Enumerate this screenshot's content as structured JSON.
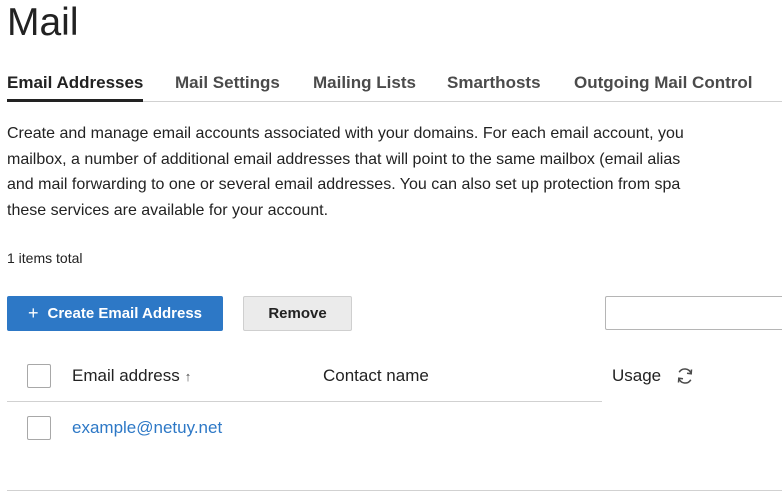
{
  "page": {
    "title": "Mail"
  },
  "tabs": [
    {
      "label": "Email Addresses",
      "active": true
    },
    {
      "label": "Mail Settings",
      "active": false
    },
    {
      "label": "Mailing Lists",
      "active": false
    },
    {
      "label": "Smarthosts",
      "active": false
    },
    {
      "label": "Outgoing Mail Control",
      "active": false
    }
  ],
  "description": {
    "lines": [
      "Create and manage email accounts associated with your domains. For each email account, you",
      "mailbox, a number of additional email addresses that will point to the same mailbox (email alias",
      "and mail forwarding to one or several email addresses. You can also set up protection from spa",
      "these services are available for your account."
    ]
  },
  "list": {
    "items_total": "1 items total",
    "toolbar": {
      "create_label": "Create Email Address",
      "create_icon": "plus-icon",
      "remove_label": "Remove",
      "search_value": ""
    },
    "columns": {
      "email": "Email address",
      "email_sort_icon": "arrow-up-icon",
      "contact": "Contact name",
      "usage": "Usage",
      "usage_icon": "refresh-icon"
    },
    "rows": [
      {
        "email": "example@netuy.net",
        "contact": "",
        "usage": ""
      }
    ]
  },
  "colors": {
    "accent": "#2d78c6",
    "text": "#222222",
    "divider": "#d1d1d1"
  }
}
